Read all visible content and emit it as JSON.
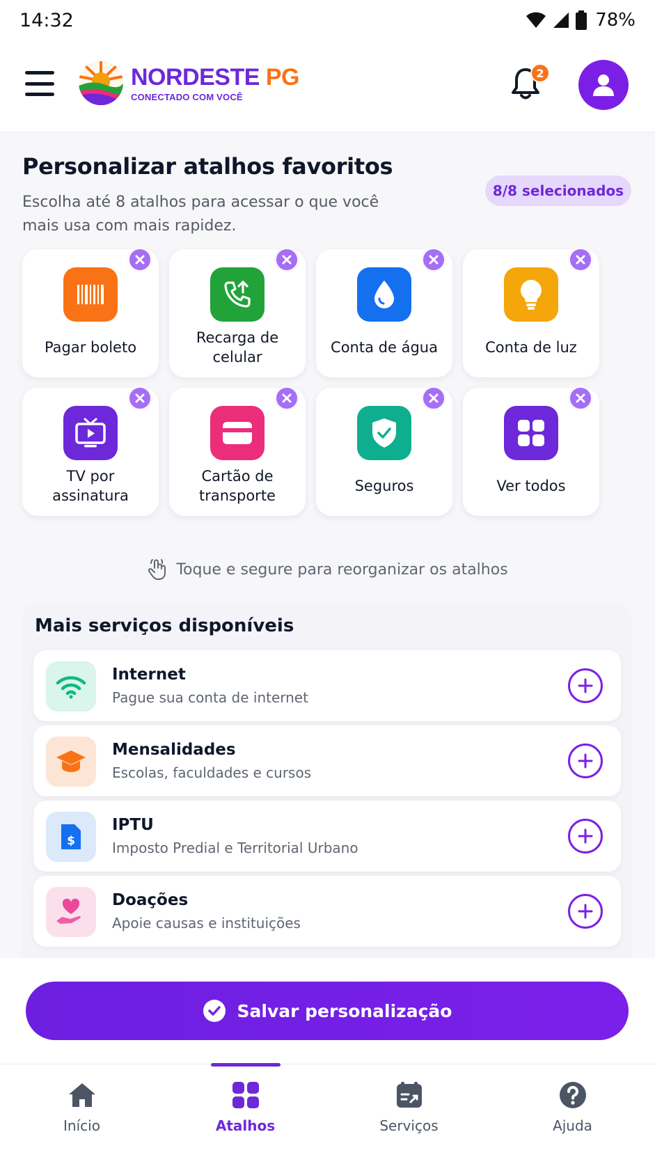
{
  "status_bar": {
    "time": "14:32",
    "battery": "78%"
  },
  "header": {
    "brand_part1": "NORDESTE",
    "brand_part2": "PG",
    "tagline": "CONECTADO COM VOCÊ",
    "notifications_count": "2",
    "icons": [
      "menu-icon",
      "bell-icon",
      "user-icon"
    ]
  },
  "section": {
    "title": "Personalizar atalhos favoritos",
    "subtitle": "Escolha até 8 atalhos para acessar o que você mais usa com mais rapidez.",
    "selected_badge": "8/8 selecionados"
  },
  "shortcuts": [
    {
      "label": "Pagar boleto",
      "icon": "barcode-icon",
      "color": "#f97316"
    },
    {
      "label": "Recarga de celular",
      "icon": "phone-recharge-icon",
      "color": "#22a33a"
    },
    {
      "label": "Conta de água",
      "icon": "water-drop-icon",
      "color": "#1570ef"
    },
    {
      "label": "Conta de luz",
      "icon": "lightbulb-icon",
      "color": "#f5a60b"
    },
    {
      "label": "TV por assinatura",
      "icon": "tv-icon",
      "color": "#6d28d9"
    },
    {
      "label": "Cartão de transporte",
      "icon": "card-icon",
      "color": "#ec2d7a"
    },
    {
      "label": "Seguros",
      "icon": "shield-check-icon",
      "color": "#0fae8f"
    },
    {
      "label": "Ver todos",
      "icon": "grid-icon",
      "color": "#6d28d9"
    }
  ],
  "hint": "Toque e segure para reorganizar os atalhos",
  "more_services": {
    "title": "Mais serviços disponíveis",
    "items": [
      {
        "name": "Internet",
        "description": "Pague sua conta de internet",
        "icon": "wifi-icon",
        "color": "#10b981",
        "bg": "#d9f5ec"
      },
      {
        "name": "Mensalidades",
        "description": "Escolas, faculdades e cursos",
        "icon": "graduation-cap-icon",
        "color": "#f97316",
        "bg": "#fde5d6"
      },
      {
        "name": "IPTU",
        "description": "Imposto Predial e Territorial Urbano",
        "icon": "tax-document-icon",
        "color": "#1570ef",
        "bg": "#dbe9fb"
      },
      {
        "name": "Doações",
        "description": "Apoie causas e instituições",
        "icon": "heart-hand-icon",
        "color": "#ec4899",
        "bg": "#fbe0ec"
      }
    ]
  },
  "save_button": "Salvar personalização",
  "bottom_nav": [
    {
      "label": "Início",
      "icon": "home-icon",
      "active": false
    },
    {
      "label": "Atalhos",
      "icon": "grid-icon",
      "active": true
    },
    {
      "label": "Serviços",
      "icon": "services-icon",
      "active": false
    },
    {
      "label": "Ajuda",
      "icon": "help-icon",
      "active": false
    }
  ],
  "colors": {
    "primary": "#7c1fe6",
    "accent": "#f97316",
    "remove": "#a56ef5"
  }
}
